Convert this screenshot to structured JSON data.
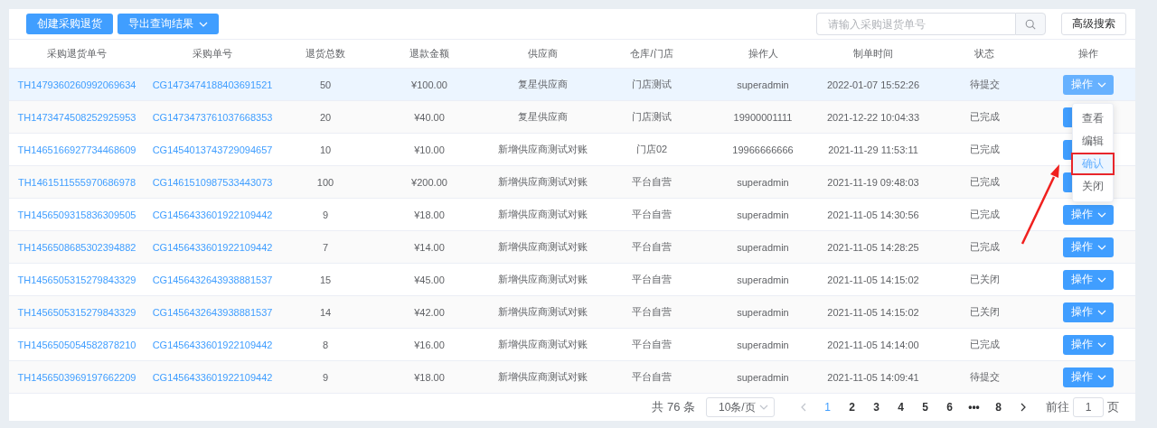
{
  "toolbar": {
    "buttons": [
      {
        "label": "创建采购退货",
        "kind": "plain"
      },
      {
        "label": "导出查询结果",
        "kind": "dropdown"
      }
    ],
    "search": {
      "placeholder": "请输入采购退货单号"
    },
    "advanced_search": "高级搜索"
  },
  "table": {
    "columns": [
      "采购退货单号",
      "采购单号",
      "退货总数",
      "退款金额",
      "供应商",
      "仓库/门店",
      "操作人",
      "制单时间",
      "状态",
      "操作"
    ],
    "rows": [
      {
        "return_no": "TH1479360260992069634",
        "purchase_no": "CG1473474188403691521",
        "qty": "50",
        "amount": "¥100.00",
        "supplier": "复星供应商",
        "store": "门店测试",
        "operator": "superadmin",
        "time": "2022-01-07 15:52:26",
        "status": "待提交",
        "action": "操作",
        "hovered": true
      },
      {
        "return_no": "TH1473474508252925953",
        "purchase_no": "CG1473473761037668353",
        "qty": "20",
        "amount": "¥40.00",
        "supplier": "复星供应商",
        "store": "门店测试",
        "operator": "19900001111",
        "time": "2021-12-22 10:04:33",
        "status": "已完成",
        "hovered": false
      },
      {
        "return_no": "TH1465166927734468609",
        "purchase_no": "CG1454013743729094657",
        "qty": "10",
        "amount": "¥10.00",
        "supplier": "新增供应商测试对账",
        "store": "门店02",
        "operator": "19966666666",
        "time": "2021-11-29 11:53:11",
        "status": "已完成",
        "hovered": false
      },
      {
        "return_no": "TH1461511555970686978",
        "purchase_no": "CG1461510987533443073",
        "qty": "100",
        "amount": "¥200.00",
        "supplier": "新增供应商测试对账",
        "store": "平台自营",
        "operator": "superadmin",
        "time": "2021-11-19 09:48:03",
        "status": "已完成",
        "hovered": false
      },
      {
        "return_no": "TH1456509315836309505",
        "purchase_no": "CG1456433601922109442",
        "qty": "9",
        "amount": "¥18.00",
        "supplier": "新增供应商测试对账",
        "store": "平台自营",
        "operator": "superadmin",
        "time": "2021-11-05 14:30:56",
        "status": "已完成",
        "action": "操作",
        "hovered": false
      },
      {
        "return_no": "TH1456508685302394882",
        "purchase_no": "CG1456433601922109442",
        "qty": "7",
        "amount": "¥14.00",
        "supplier": "新增供应商测试对账",
        "store": "平台自营",
        "operator": "superadmin",
        "time": "2021-11-05 14:28:25",
        "status": "已完成",
        "action": "操作",
        "hovered": false
      },
      {
        "return_no": "TH1456505315279843329",
        "purchase_no": "CG1456432643938881537",
        "qty": "15",
        "amount": "¥45.00",
        "supplier": "新增供应商测试对账",
        "store": "平台自营",
        "operator": "superadmin",
        "time": "2021-11-05 14:15:02",
        "status": "已关闭",
        "action": "操作",
        "hovered": false
      },
      {
        "return_no": "TH1456505315279843329",
        "purchase_no": "CG1456432643938881537",
        "qty": "14",
        "amount": "¥42.00",
        "supplier": "新增供应商测试对账",
        "store": "平台自营",
        "operator": "superadmin",
        "time": "2021-11-05 14:15:02",
        "status": "已关闭",
        "action": "操作",
        "hovered": false
      },
      {
        "return_no": "TH1456505054582878210",
        "purchase_no": "CG1456433601922109442",
        "qty": "8",
        "amount": "¥16.00",
        "supplier": "新增供应商测试对账",
        "store": "平台自营",
        "operator": "superadmin",
        "time": "2021-11-05 14:14:00",
        "status": "已完成",
        "action": "操作",
        "hovered": false
      },
      {
        "return_no": "TH1456503969197662209",
        "purchase_no": "CG1456433601922109442",
        "qty": "9",
        "amount": "¥18.00",
        "supplier": "新增供应商测试对账",
        "store": "平台自营",
        "operator": "superadmin",
        "time": "2021-11-05 14:09:41",
        "status": "待提交",
        "action": "操作",
        "hovered": false
      }
    ]
  },
  "action_menu": {
    "items": [
      {
        "label": "查看",
        "highlighted": false
      },
      {
        "label": "编辑",
        "highlighted": false
      },
      {
        "label": "确认",
        "highlighted": true
      },
      {
        "label": "关闭",
        "highlighted": false
      }
    ]
  },
  "pagination": {
    "total": "共 76 条",
    "page_size": "10条/页",
    "pages": [
      {
        "label": "1",
        "selected": true
      },
      {
        "label": "2",
        "selected": false
      },
      {
        "label": "3",
        "selected": false
      },
      {
        "label": "4",
        "selected": false
      },
      {
        "label": "5",
        "selected": false
      },
      {
        "label": "6",
        "selected": false
      },
      {
        "label": "•••",
        "selected": false
      },
      {
        "label": "8",
        "selected": false
      }
    ],
    "goto_label": "前往",
    "goto_value": "1",
    "goto_suffix": "页"
  }
}
